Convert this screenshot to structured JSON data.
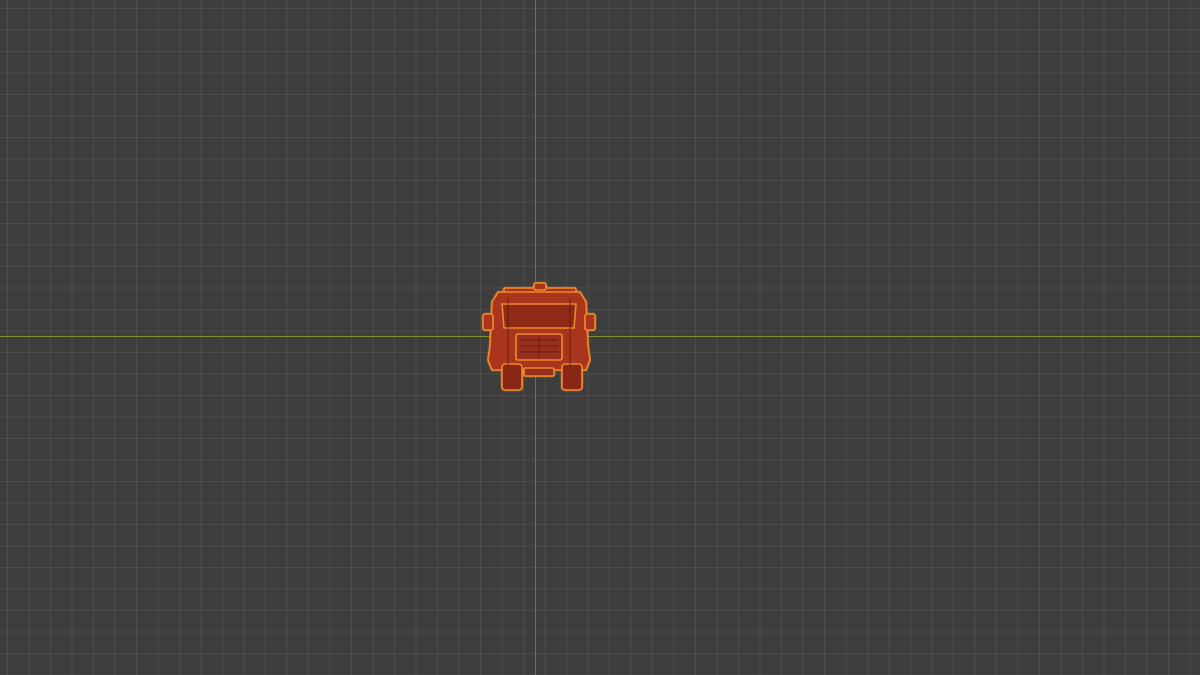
{
  "viewport": {
    "view": "3d-viewport",
    "grid": true,
    "colors": {
      "background": "#3d3d3d",
      "x_axis": "#7f8f2e",
      "y_axis": "#4f6f95",
      "object_fill": "#a9361f",
      "selection_outline": "#f08a2a"
    }
  },
  "object": {
    "kind": "vehicle",
    "selected": true,
    "icon": "truck-rear-view"
  }
}
